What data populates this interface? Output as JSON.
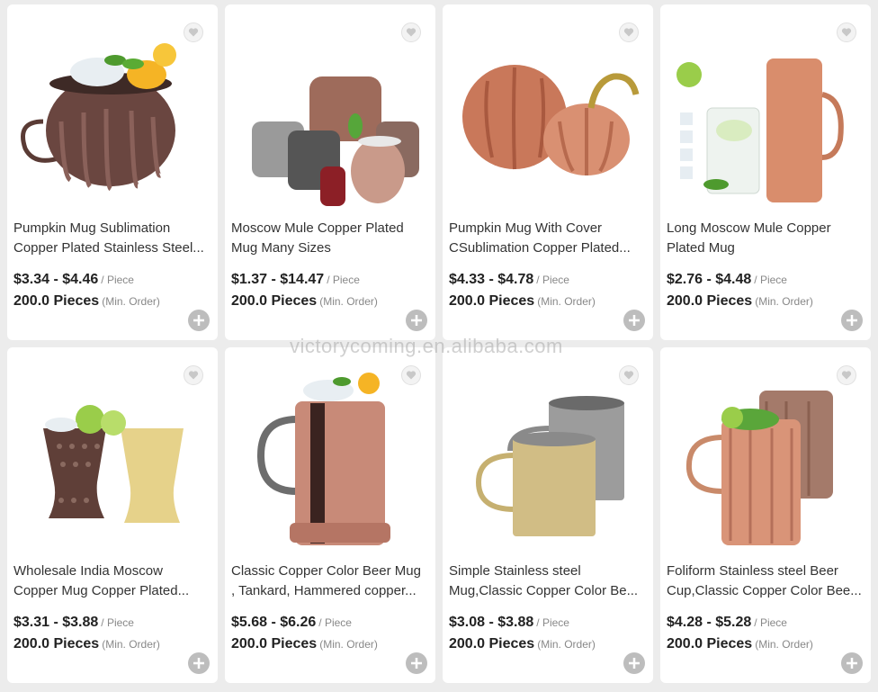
{
  "watermark": "victorycoming.en.alibaba.com",
  "products": [
    {
      "title_line1": "Pumpkin Mug Sublimation",
      "title_line2": "Copper Plated Stainless Steel...",
      "price": "$3.34 - $4.46",
      "unit": "/ Piece",
      "moq": "200.0 Pieces",
      "moq_note": "(Min. Order)"
    },
    {
      "title_line1": "Moscow Mule Copper Plated",
      "title_line2": "Mug Many Sizes",
      "price": "$1.37 - $14.47",
      "unit": "/ Piece",
      "moq": "200.0 Pieces",
      "moq_note": "(Min. Order)"
    },
    {
      "title_line1": "Pumpkin Mug With Cover",
      "title_line2": "CSublimation Copper Plated...",
      "price": "$4.33 - $4.78",
      "unit": "/ Piece",
      "moq": "200.0 Pieces",
      "moq_note": "(Min. Order)"
    },
    {
      "title_line1": "Long Moscow Mule Copper",
      "title_line2": "Plated Mug",
      "price": "$2.76 - $4.48",
      "unit": "/ Piece",
      "moq": "200.0 Pieces",
      "moq_note": "(Min. Order)"
    },
    {
      "title_line1": "Wholesale India Moscow",
      "title_line2": "Copper Mug Copper Plated...",
      "price": "$3.31 - $3.88",
      "unit": "/ Piece",
      "moq": "200.0 Pieces",
      "moq_note": "(Min. Order)"
    },
    {
      "title_line1": "Classic Copper Color Beer Mug",
      "title_line2": ", Tankard, Hammered copper...",
      "price": "$5.68 - $6.26",
      "unit": "/ Piece",
      "moq": "200.0 Pieces",
      "moq_note": "(Min. Order)"
    },
    {
      "title_line1": "Simple Stainless steel",
      "title_line2": "Mug,Classic Copper Color Be...",
      "price": "$3.08 - $3.88",
      "unit": "/ Piece",
      "moq": "200.0 Pieces",
      "moq_note": "(Min. Order)"
    },
    {
      "title_line1": "Foliform Stainless steel Beer",
      "title_line2": "Cup,Classic Copper Color Bee...",
      "price": "$4.28 - $5.28",
      "unit": "/ Piece",
      "moq": "200.0 Pieces",
      "moq_note": "(Min. Order)"
    }
  ],
  "icons": {
    "favorite": "heart-icon",
    "add": "plus-icon"
  },
  "colors": {
    "background": "#ececec",
    "card": "#ffffff",
    "text": "#333333",
    "muted": "#888888",
    "add_button": "#bdbdbd"
  }
}
